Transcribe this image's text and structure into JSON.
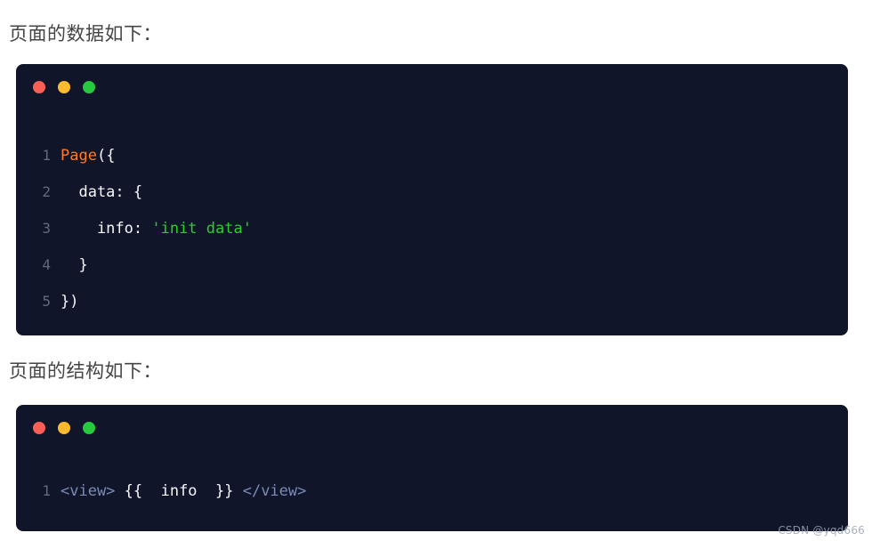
{
  "headings": {
    "data_section": "页面的数据如下：",
    "structure_section": "页面的结构如下："
  },
  "colors": {
    "page_background": "#ffffff",
    "code_background": "#10152a",
    "heading_text": "#454545",
    "line_number": "#5f6b80",
    "code_default_text": "#f5f7fa",
    "function_token": "#ff7b27",
    "string_token": "#2ecc2e",
    "tag_token": "#7b8bb5",
    "dot_red": "#fa5f56",
    "dot_yellow": "#fcbb2f",
    "dot_green": "#27c93f"
  },
  "window_controls": {
    "close_label": "",
    "minimize_label": "",
    "maximize_label": ""
  },
  "code_blocks": [
    {
      "id": "page-data-code",
      "language": "javascript",
      "lines": [
        {
          "number": "1",
          "tokens": [
            {
              "text": "Page",
              "type": "fn"
            },
            {
              "text": "({",
              "type": "plain"
            }
          ]
        },
        {
          "number": "2",
          "tokens": [
            {
              "text": "  data: {",
              "type": "plain"
            }
          ]
        },
        {
          "number": "3",
          "tokens": [
            {
              "text": "    info: ",
              "type": "plain"
            },
            {
              "text": "'init data'",
              "type": "string"
            }
          ]
        },
        {
          "number": "4",
          "tokens": [
            {
              "text": "  }",
              "type": "plain"
            }
          ]
        },
        {
          "number": "5",
          "tokens": [
            {
              "text": "})",
              "type": "plain"
            }
          ]
        }
      ]
    },
    {
      "id": "page-structure-code",
      "language": "wxml",
      "lines": [
        {
          "number": "1",
          "tokens": [
            {
              "text": "<view>",
              "type": "tag"
            },
            {
              "text": " {{  info  }} ",
              "type": "plain"
            },
            {
              "text": "</view>",
              "type": "tag"
            }
          ]
        }
      ]
    }
  ],
  "watermark": {
    "text": "CSDN @yqd666"
  }
}
